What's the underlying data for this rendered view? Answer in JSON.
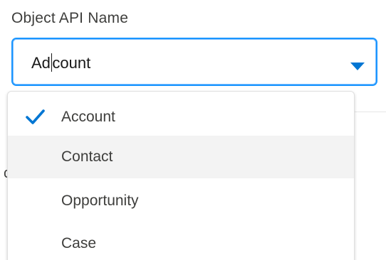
{
  "field": {
    "label": "Object API Name",
    "value_before_caret": "Ad",
    "value_after_caret": "count",
    "value": "Account",
    "accent_color": "#0176d3",
    "focus_border_color": "#1b96ff"
  },
  "dropdown": {
    "selected": "Account",
    "hovered": "Contact",
    "options": [
      {
        "label": "Account",
        "selected": true
      },
      {
        "label": "Contact",
        "selected": false
      },
      {
        "label": "Opportunity",
        "selected": false
      },
      {
        "label": "Case",
        "selected": false
      }
    ]
  },
  "icons": {
    "dropdown_arrow": "chevron-down-icon",
    "selected_marker": "check-icon"
  }
}
